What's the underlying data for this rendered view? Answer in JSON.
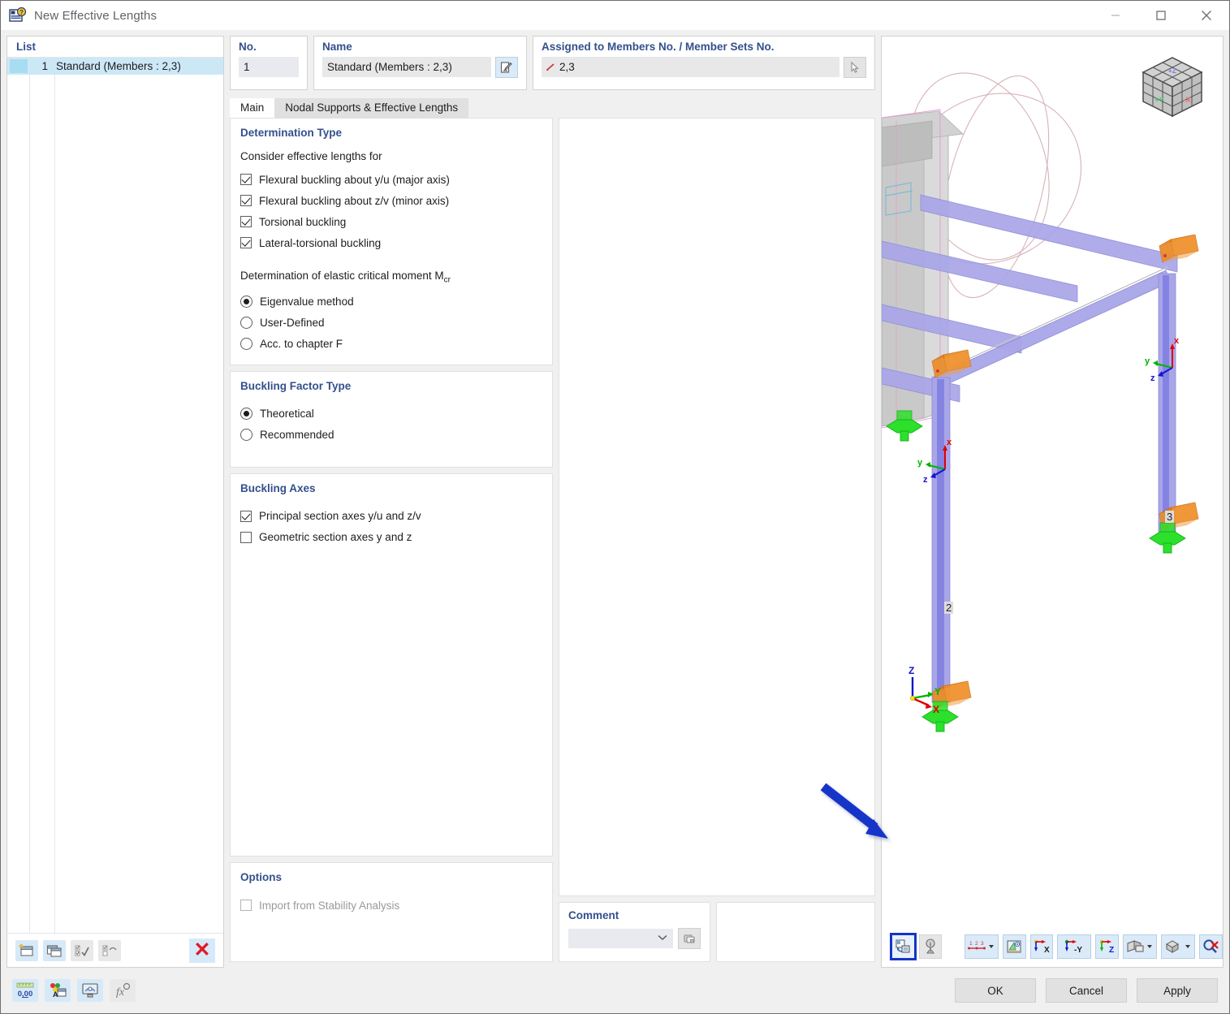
{
  "window": {
    "title": "New Effective Lengths",
    "icon": "app-icon",
    "minimize_label": "–",
    "maximize_label": "□",
    "close_label": "✕"
  },
  "list_panel": {
    "header": "List",
    "rows": [
      {
        "no": "1",
        "label": "Standard (Members : 2,3)",
        "selected": true
      }
    ],
    "toolbar": [
      {
        "name": "new-item-button",
        "glyph": "new"
      },
      {
        "name": "copy-item-button",
        "glyph": "copy"
      },
      {
        "name": "check-all-button",
        "glyph": "check-all"
      },
      {
        "name": "check-options-button",
        "glyph": "check-options"
      },
      {
        "name": "delete-item-button",
        "glyph": "x",
        "label": "✕"
      }
    ]
  },
  "header": {
    "no_label": "No.",
    "no_value": "1",
    "name_label": "Name",
    "name_value": "Standard (Members : 2,3)",
    "name_edit_icon": "edit-pencil-icon",
    "assigned_label": "Assigned to Members No. / Member Sets No.",
    "assigned_value": "2,3",
    "assigned_pick_icon": "pick-cursor-icon"
  },
  "tabs": [
    {
      "label": "Main",
      "active": true
    },
    {
      "label": "Nodal Supports & Effective Lengths",
      "active": false
    }
  ],
  "determination_type": {
    "title": "Determination Type",
    "consider_label": "Consider effective lengths for",
    "checkboxes": [
      {
        "label": "Flexural buckling about y/u (major axis)",
        "checked": true
      },
      {
        "label": "Flexural buckling about z/v (minor axis)",
        "checked": true
      },
      {
        "label": "Torsional buckling",
        "checked": true
      },
      {
        "label": "Lateral-torsional buckling",
        "checked": true
      }
    ],
    "mcr_label": "Determination of elastic critical moment M",
    "mcr_sub": "cr",
    "radios": [
      {
        "label": "Eigenvalue method",
        "selected": true
      },
      {
        "label": "User-Defined",
        "selected": false
      },
      {
        "label": "Acc. to chapter F",
        "selected": false
      }
    ]
  },
  "buckling_factor_type": {
    "title": "Buckling Factor Type",
    "radios": [
      {
        "label": "Theoretical",
        "selected": true
      },
      {
        "label": "Recommended",
        "selected": false
      }
    ]
  },
  "buckling_axes": {
    "title": "Buckling Axes",
    "checkboxes": [
      {
        "label": "Principal section axes y/u and z/v",
        "checked": true
      },
      {
        "label": "Geometric section axes y and z",
        "checked": false
      }
    ]
  },
  "options": {
    "title": "Options",
    "checkboxes": [
      {
        "label": "Import from Stability Analysis",
        "checked": false,
        "disabled": true
      }
    ]
  },
  "comment": {
    "title": "Comment",
    "value": "",
    "placeholder": "",
    "dropdown_icon": "chevron-down-icon",
    "pick_icon": "comment-library-icon"
  },
  "viewport": {
    "member_labels": [
      "2",
      "3"
    ],
    "nav_cube": {
      "face_left": "+Y",
      "face_right": "-X",
      "face_top": "+Z"
    },
    "local_axes": {
      "x": "x",
      "y": "y",
      "z": "z"
    },
    "global_axes": {
      "x": "X",
      "y": "Y",
      "z": "Z"
    },
    "toolbar": [
      {
        "name": "render-mode-button",
        "icon": "render-toggle-icon",
        "selected": true,
        "state": "on"
      },
      {
        "name": "info-marker-button",
        "icon": "info-pin-icon",
        "selected": false,
        "state": "gray"
      },
      {
        "name": "numbering-button",
        "icon": "numbering-icon",
        "selected": false,
        "state": "on",
        "dropdown": true
      },
      {
        "name": "view-angle-button",
        "icon": "view-angle-icon",
        "selected": false,
        "state": "on"
      },
      {
        "name": "view-x-button",
        "icon": "axis-x-icon",
        "label": "X",
        "selected": false,
        "state": "on"
      },
      {
        "name": "view-minus-y-button",
        "icon": "axis-minus-y-icon",
        "label": "-Y",
        "selected": false,
        "state": "on"
      },
      {
        "name": "view-z-button",
        "icon": "axis-z-icon",
        "label": "Z",
        "selected": false,
        "state": "on"
      },
      {
        "name": "display-mode-button",
        "icon": "display-mode-icon",
        "selected": false,
        "state": "on",
        "dropdown": true
      },
      {
        "name": "box-view-button",
        "icon": "box-view-icon",
        "selected": false,
        "state": "on",
        "dropdown": true
      },
      {
        "name": "reset-zoom-button",
        "icon": "reset-zoom-icon",
        "selected": false,
        "state": "on"
      }
    ],
    "colors": {
      "member": "#a9a6e8",
      "member_selected": "#7b79e0",
      "support": "#2ce02c",
      "hinge": "#ef8a22",
      "concrete": "#c9c9c9",
      "guide": "#d7b2b8",
      "axis_x": "#e00000",
      "axis_y": "#00b400",
      "axis_z": "#1414d2"
    }
  },
  "annotation": {
    "arrow_color": "#1434c8",
    "points_to": "render-mode-button"
  },
  "footer": {
    "tools": [
      {
        "name": "units-button",
        "icon": "units-0-00-icon",
        "label": "0,00"
      },
      {
        "name": "colors-button",
        "icon": "color-palette-icon"
      },
      {
        "name": "display-properties-button",
        "icon": "display-properties-icon"
      },
      {
        "name": "formula-button",
        "icon": "fx-icon"
      }
    ],
    "buttons": [
      {
        "name": "ok-button",
        "label": "OK"
      },
      {
        "name": "cancel-button",
        "label": "Cancel"
      },
      {
        "name": "apply-button",
        "label": "Apply"
      }
    ]
  }
}
